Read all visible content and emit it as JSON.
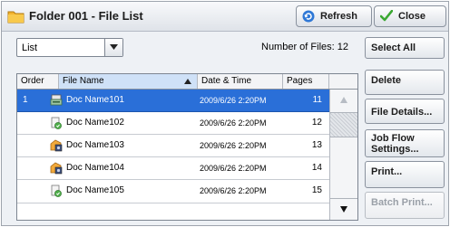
{
  "window": {
    "title": "Folder 001 - File List"
  },
  "toolbar": {
    "refresh_label": "Refresh",
    "close_label": "Close"
  },
  "view": {
    "selected": "List"
  },
  "file_count": {
    "label": "Number of Files:",
    "value": "12"
  },
  "table": {
    "columns": {
      "order": "Order",
      "name": "File Name",
      "date": "Date & Time",
      "pages": "Pages"
    },
    "sort": {
      "column": "File Name",
      "direction": "ascending"
    },
    "rows": [
      {
        "order": "1",
        "icon": "scan-document-icon",
        "name": "Doc Name101",
        "date": "2009/6/26 2:20PM",
        "pages": "11",
        "selected": true
      },
      {
        "order": "",
        "icon": "fax-document-icon",
        "name": "Doc Name102",
        "date": "2009/6/26 2:20PM",
        "pages": "12",
        "selected": false
      },
      {
        "order": "",
        "icon": "mailbox-document-icon",
        "name": "Doc Name103",
        "date": "2009/6/26 2:20PM",
        "pages": "13",
        "selected": false
      },
      {
        "order": "",
        "icon": "mailbox-document-icon",
        "name": "Doc Name104",
        "date": "2009/6/26 2:20PM",
        "pages": "14",
        "selected": false
      },
      {
        "order": "",
        "icon": "fax-document-icon",
        "name": "Doc Name105",
        "date": "2009/6/26 2:20PM",
        "pages": "15",
        "selected": false
      }
    ]
  },
  "actions": {
    "select_all": "Select All",
    "delete": "Delete",
    "file_details": "File Details...",
    "job_flow_line1": "Job Flow",
    "job_flow_line2": "Settings...",
    "print": "Print...",
    "batch_print": "Batch Print..."
  },
  "colors": {
    "selection": "#2a6fd8",
    "header_sorted": "#cfe1f7",
    "close_check": "#3aa832",
    "refresh_icon": "#2f78d6"
  }
}
